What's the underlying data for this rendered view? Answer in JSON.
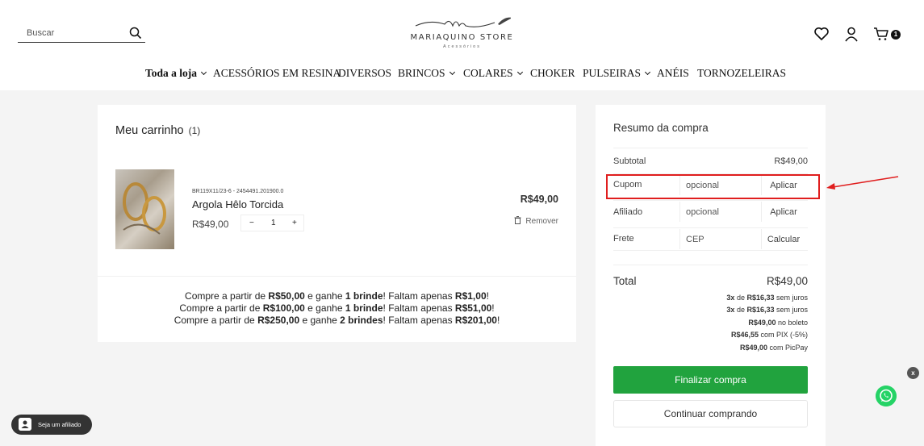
{
  "header": {
    "search_placeholder": "Buscar",
    "logo_name": "MARIAQUINO STORE",
    "logo_sub": "Acessórios",
    "cart_count": "1"
  },
  "nav": {
    "items": [
      {
        "label": "Toda a loja",
        "dropdown": true
      },
      {
        "label": "ACESSÓRIOS EM RESINA",
        "dropdown": false
      },
      {
        "label": "DIVERSOS",
        "dropdown": false
      },
      {
        "label": "BRINCOS",
        "dropdown": true
      },
      {
        "label": "COLARES",
        "dropdown": true
      },
      {
        "label": "CHOKER",
        "dropdown": false
      },
      {
        "label": "PULSEIRAS",
        "dropdown": true
      },
      {
        "label": "ANÉIS",
        "dropdown": false
      },
      {
        "label": "TORNOZELEIRAS",
        "dropdown": false
      }
    ]
  },
  "cart": {
    "title": "Meu carrinho",
    "count": "(1)",
    "item": {
      "sku": "BR119X11/23-6 - 2454491.201900.0",
      "name": "Argola Hêlo Torcida",
      "unit_price": "R$49,00",
      "quantity": "1",
      "minus": "−",
      "plus": "+",
      "line_price": "R$49,00",
      "remove_label": "Remover"
    },
    "gifts": [
      {
        "pre": "Compre a partir de ",
        "threshold": "R$50,00",
        "mid": " e ganhe ",
        "gift": "1 brinde",
        "post": "! Faltam apenas ",
        "remaining": "R$1,00",
        "end": "!"
      },
      {
        "pre": "Compre a partir de ",
        "threshold": "R$100,00",
        "mid": " e ganhe ",
        "gift": "1 brinde",
        "post": "! Faltam apenas ",
        "remaining": "R$51,00",
        "end": "!"
      },
      {
        "pre": "Compre a partir de ",
        "threshold": "R$250,00",
        "mid": " e ganhe ",
        "gift": "2 brindes",
        "post": "! Faltam apenas ",
        "remaining": "R$201,00",
        "end": "!"
      }
    ]
  },
  "summary": {
    "title": "Resumo da compra",
    "subtotal_label": "Subtotal",
    "subtotal_value": "R$49,00",
    "coupon_label": "Cupom",
    "coupon_placeholder": "opcional",
    "coupon_button": "Aplicar",
    "affiliate_label": "Afiliado",
    "affiliate_placeholder": "opcional",
    "affiliate_button": "Aplicar",
    "shipping_label": "Frete",
    "shipping_placeholder": "CEP",
    "shipping_button": "Calcular",
    "total_label": "Total",
    "total_value": "R$49,00",
    "installments": [
      {
        "bold": "3x",
        "mid": " de ",
        "value": "R$16,33",
        "suffix": " sem juros"
      },
      {
        "bold": "3x",
        "mid": " de ",
        "value": "R$16,33",
        "suffix": " sem juros"
      },
      {
        "bold": "",
        "mid": "",
        "value": "R$49,00",
        "suffix": " no boleto"
      },
      {
        "bold": "",
        "mid": "",
        "value": "R$46,55",
        "suffix": " com PIX (-5%)"
      },
      {
        "bold": "",
        "mid": "",
        "value": "R$49,00",
        "suffix": " com PicPay"
      }
    ],
    "finish_button": "Finalizar compra",
    "continue_button": "Continuar comprando"
  },
  "widgets": {
    "affiliate_pill": "Seja um afiliado",
    "whatsapp_close": "x"
  },
  "colors": {
    "highlight": "#e01e1e",
    "finish": "#21a33e",
    "whatsapp": "#25d366"
  }
}
